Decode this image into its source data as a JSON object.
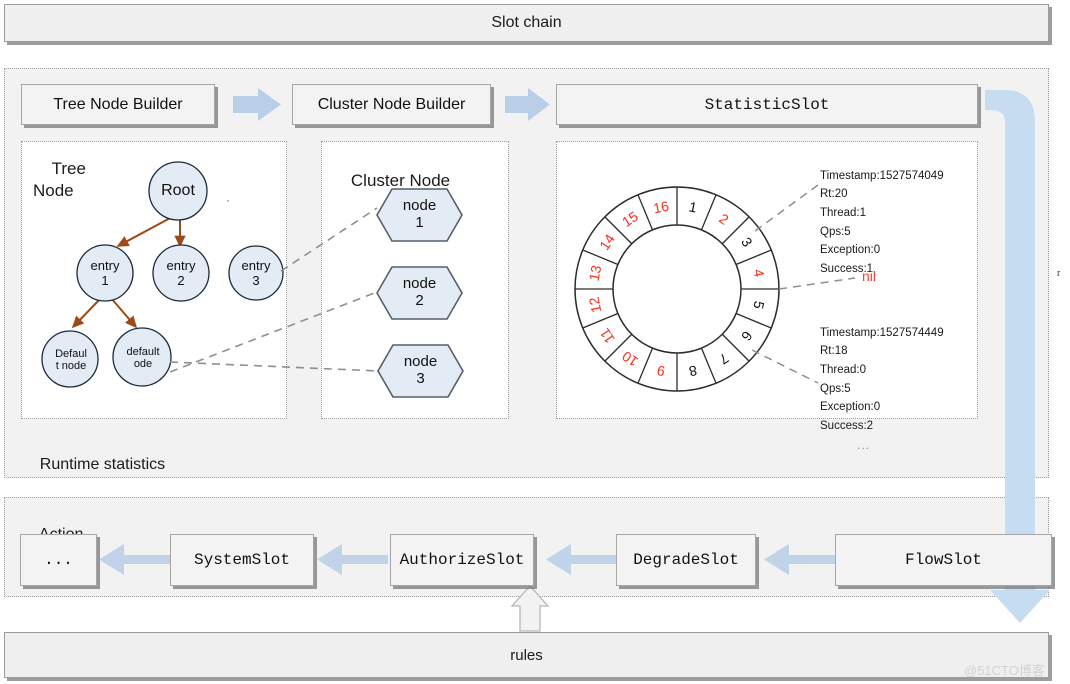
{
  "header": {
    "title": "Slot chain"
  },
  "pipeline": {
    "steps": [
      {
        "label": "Tree Node Builder"
      },
      {
        "label": "Cluster Node Builder"
      },
      {
        "label": "StatisticSlot"
      }
    ],
    "runtime_label": "Runtime statistics",
    "ellipsis": "..."
  },
  "tree_panel": {
    "title": "Tree\nNode",
    "nodes": [
      {
        "id": "root",
        "label": "Root"
      },
      {
        "id": "entry1",
        "label": "entry\n1"
      },
      {
        "id": "entry2",
        "label": "entry\n2"
      },
      {
        "id": "entry3",
        "label": "entry\n3"
      },
      {
        "id": "default1",
        "label": "Defaul\nt node"
      },
      {
        "id": "default2",
        "label": "default\node"
      }
    ]
  },
  "cluster_panel": {
    "title": "Cluster Node",
    "nodes": [
      {
        "label": "node\n1"
      },
      {
        "label": "node\n2"
      },
      {
        "label": "node\n3"
      }
    ]
  },
  "statistic_panel": {
    "nil_label": "nil",
    "ring": {
      "slots": [
        {
          "n": "1",
          "color": "#111111"
        },
        {
          "n": "2",
          "color": "#ff2b19"
        },
        {
          "n": "3",
          "color": "#111111"
        },
        {
          "n": "4",
          "color": "#ff2b19"
        },
        {
          "n": "5",
          "color": "#111111"
        },
        {
          "n": "6",
          "color": "#111111"
        },
        {
          "n": "7",
          "color": "#111111"
        },
        {
          "n": "8",
          "color": "#111111"
        },
        {
          "n": "9",
          "color": "#ff2b19"
        },
        {
          "n": "10",
          "color": "#ff2b19"
        },
        {
          "n": "11",
          "color": "#ff2b19"
        },
        {
          "n": "12",
          "color": "#ff2b19"
        },
        {
          "n": "13",
          "color": "#ff2b19"
        },
        {
          "n": "14",
          "color": "#ff2b19"
        },
        {
          "n": "15",
          "color": "#ff2b19"
        },
        {
          "n": "16",
          "color": "#ff2b19"
        }
      ]
    },
    "bucket_top": "Timestamp:1527574049\nRt:20\nThread:1\nQps:5\nException:0\nSuccess:1",
    "bucket_bottom": "Timestamp:1527574449\nRt:18\nThread:0\nQps:5\nException:0\nSuccess:2"
  },
  "action_panel": {
    "title": "Action",
    "slots": [
      {
        "label": "..."
      },
      {
        "label": "SystemSlot"
      },
      {
        "label": "AuthorizeSlot"
      },
      {
        "label": "DegradeSlot"
      },
      {
        "label": "FlowSlot"
      }
    ]
  },
  "rules": {
    "label": "rules"
  },
  "misc": {
    "watermark": "@51CTO博客",
    "stray_r": "r"
  },
  "colors": {
    "arrow_blue": "#b9cfe7",
    "tree_arrow_brown": "#9c4a17",
    "node_fill": "#e3ebf5",
    "node_stroke": "#3d4f63",
    "dash_gray": "#8f8f8f",
    "red": "#ff2b19"
  }
}
